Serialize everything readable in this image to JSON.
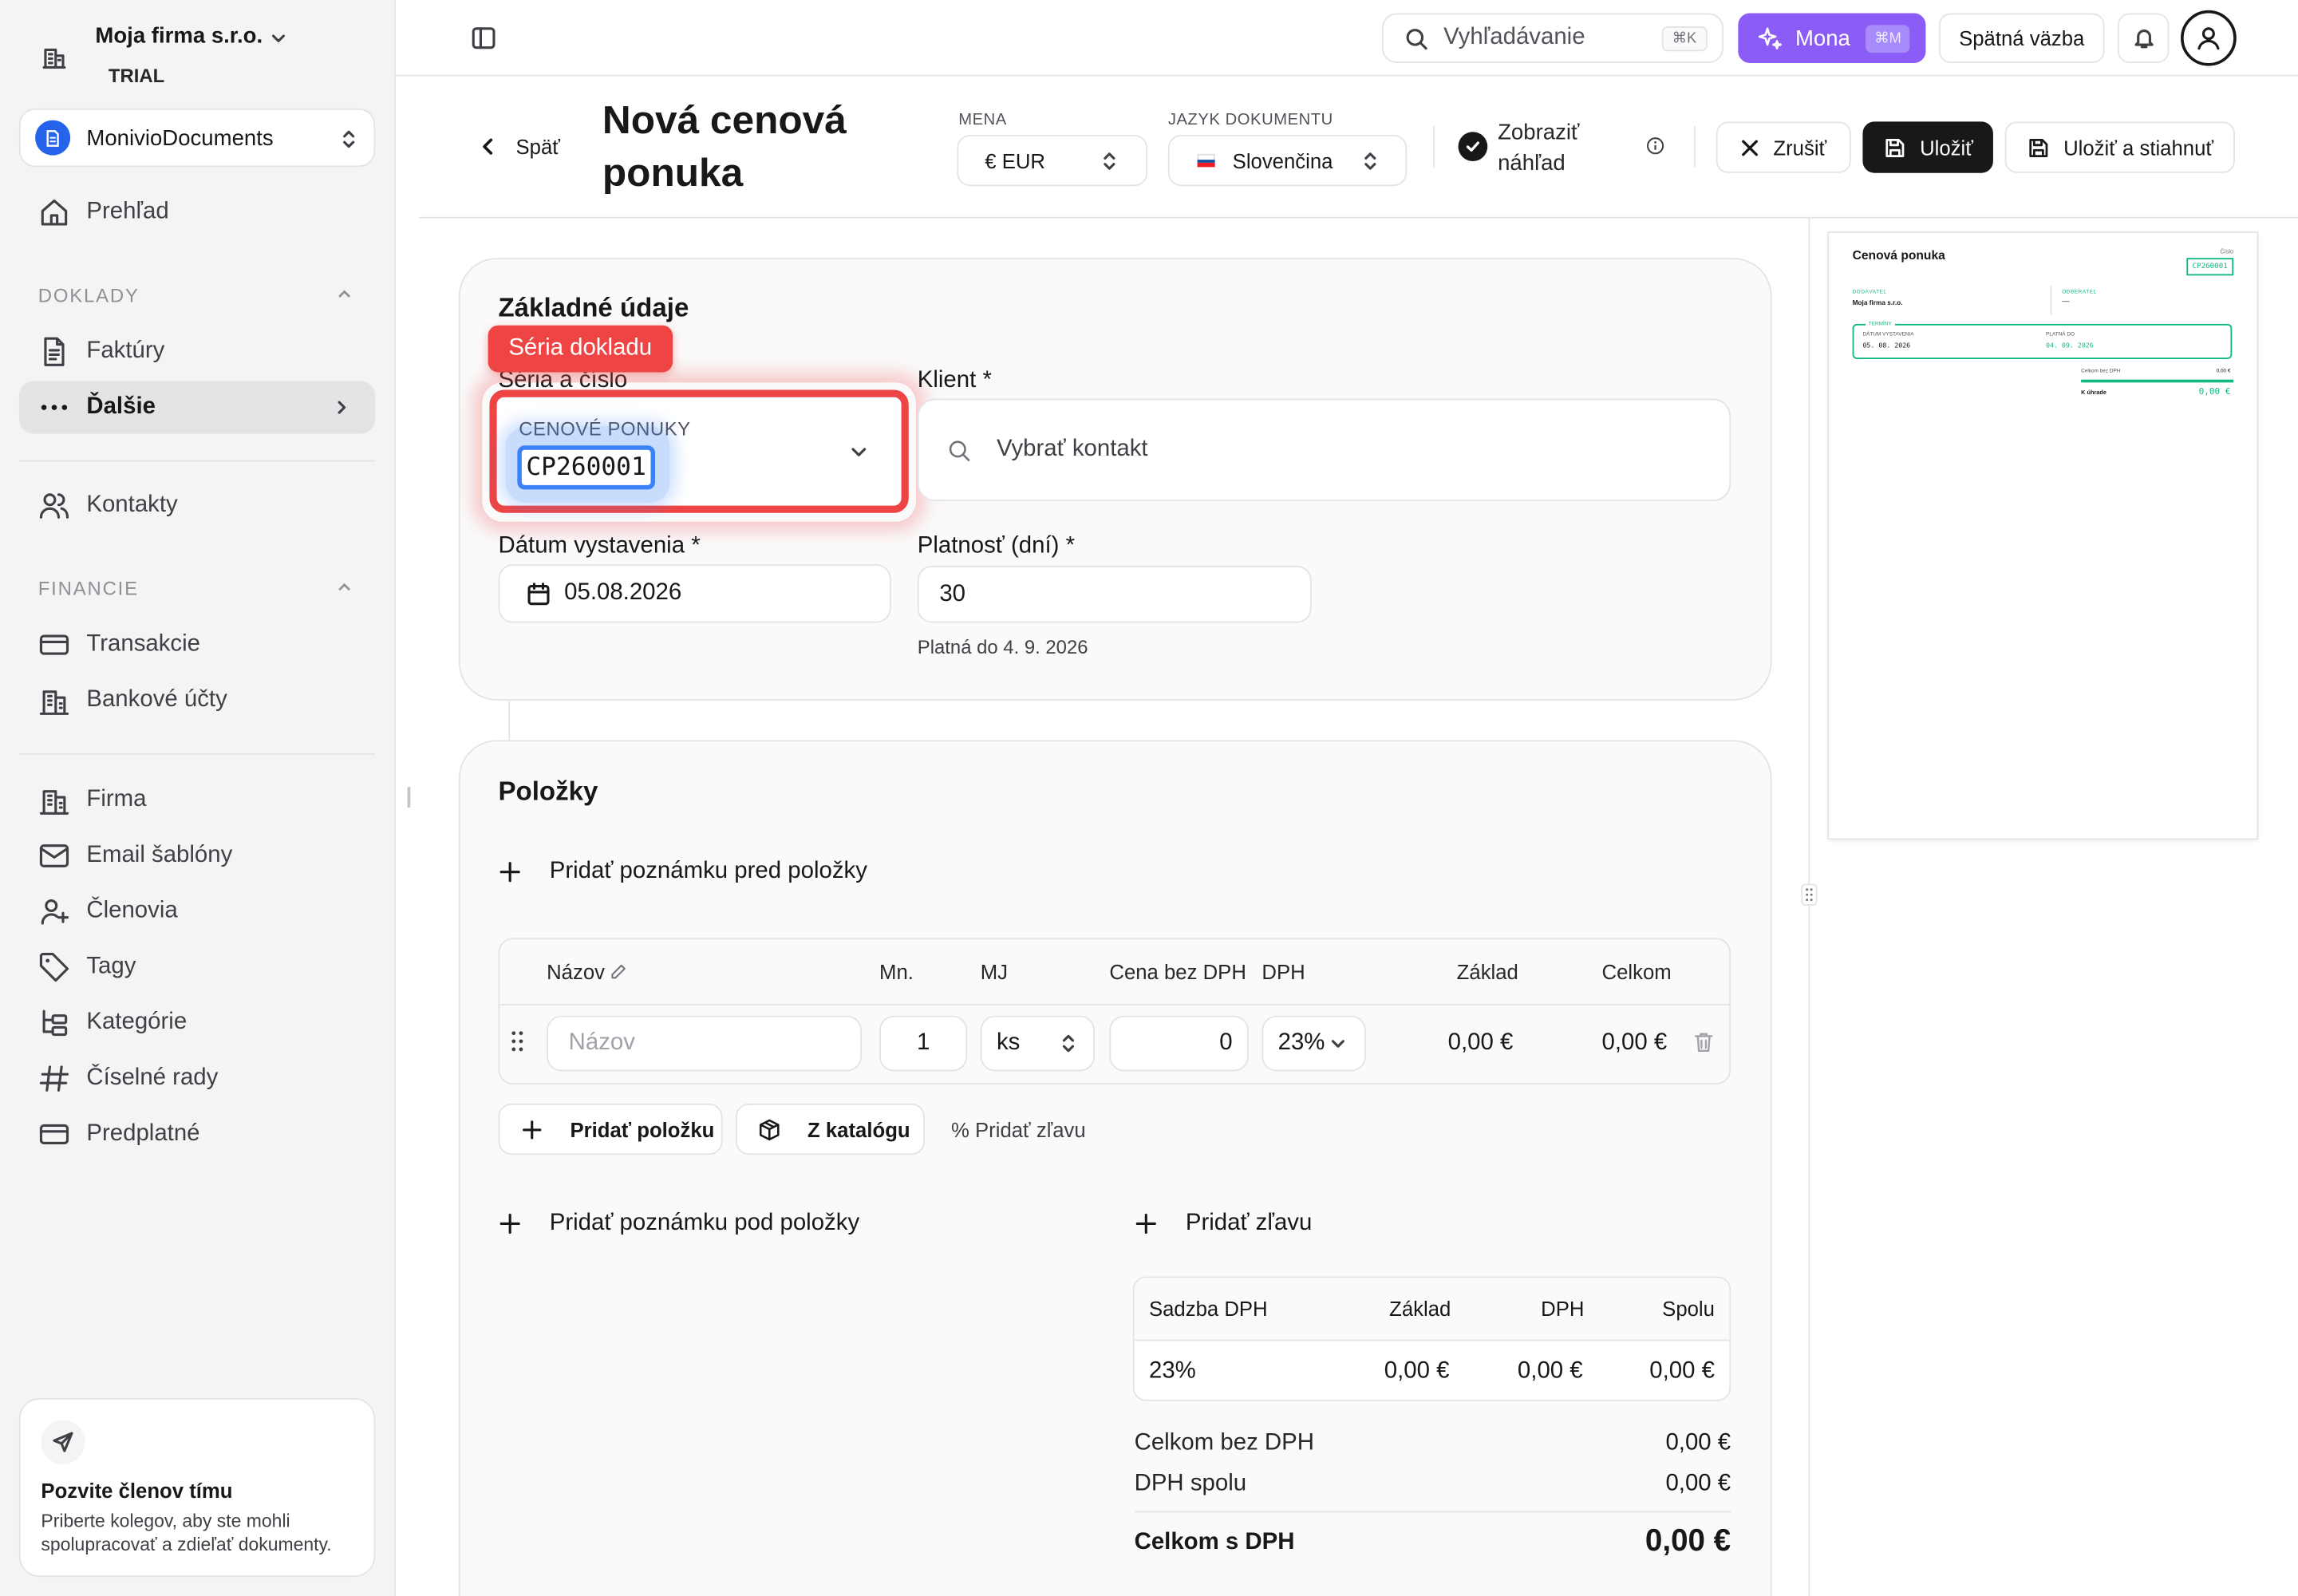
{
  "sidebar": {
    "company_name": "Moja firma s.r.o.",
    "company_plan": "TRIAL",
    "workspace_name": "MonivioDocuments",
    "overview": "Prehľad",
    "section_documents": "DOKLADY",
    "invoices": "Faktúry",
    "more": "Ďalšie",
    "contacts": "Kontakty",
    "section_finance": "FINANCIE",
    "transactions": "Transakcie",
    "bank_accounts": "Bankové účty",
    "company": "Firma",
    "email_templates": "Email šablóny",
    "members": "Členovia",
    "tags": "Tagy",
    "categories": "Kategórie",
    "number_series": "Číselné rady",
    "subscription": "Predplatné",
    "invite_title": "Pozvite členov tímu",
    "invite_text": "Priberte kolegov, aby ste mohli spolupracovať a zdieľať dokumenty."
  },
  "topbar": {
    "search_placeholder": "Vyhľadávanie",
    "search_shortcut": "⌘K",
    "ai_label": "Mona",
    "ai_shortcut": "⌘M",
    "feedback": "Spätná väzba"
  },
  "header": {
    "back": "Späť",
    "title_line1": "Nová cenová",
    "title_line2": "ponuka",
    "currency_label": "MENA",
    "currency_value": "€ EUR",
    "language_label": "JAZYK DOKUMENTU",
    "language_value": "Slovenčina",
    "preview_line1": "Zobraziť",
    "preview_line2": "náhľad",
    "cancel": "Zrušiť",
    "save": "Uložiť",
    "save_download": "Uložiť a stiahnuť"
  },
  "basic": {
    "title": "Základné údaje",
    "tooltip": "Séria dokladu",
    "series_label": "Séria a číslo",
    "series_name": "CENOVÉ PONUKY",
    "series_number": "CP260001",
    "client_label": "Klient *",
    "client_placeholder": "Vybrať kontakt",
    "issue_date_label": "Dátum vystavenia *",
    "issue_date": "05.08.2026",
    "validity_label": "Platnosť (dní) *",
    "validity": "30",
    "valid_until": "Platná do 4. 9. 2026"
  },
  "items": {
    "title": "Položky",
    "add_note_before": "Pridať poznámku pred položky",
    "columns": [
      "Názov",
      "Mn.",
      "MJ",
      "Cena bez DPH",
      "DPH",
      "Základ",
      "Celkom"
    ],
    "row": {
      "name_placeholder": "Názov",
      "qty": "1",
      "unit": "ks",
      "price": "0",
      "vat": "23%",
      "base": "0,00 €",
      "total": "0,00 €"
    },
    "add_item": "Pridať položku",
    "from_catalog": "Z katalógu",
    "add_discount_small": "% Pridať zľavu",
    "add_note_after": "Pridať poznámku pod položky",
    "add_discount": "Pridať zľavu"
  },
  "summary": {
    "columns": [
      "Sadzba DPH",
      "Základ",
      "DPH",
      "Spolu"
    ],
    "row": [
      "23%",
      "0,00 €",
      "0,00 €",
      "0,00 €"
    ],
    "total_without_vat_label": "Celkom bez DPH",
    "total_without_vat": "0,00 €",
    "vat_total_label": "DPH spolu",
    "vat_total": "0,00 €",
    "total_with_vat_label": "Celkom s DPH",
    "total_with_vat": "0,00 €"
  },
  "preview": {
    "title": "Cenová ponuka",
    "number_label": "Číslo",
    "number": "CP260001",
    "supplier_label": "DODÁVATEĽ",
    "supplier": "Moja firma s.r.o.",
    "customer_label": "ODBERATEĽ",
    "customer": "—",
    "terms_label": "TERMÍNY",
    "issue_label": "DÁTUM VYSTAVENIA",
    "issue": "05. 08. 2026",
    "valid_label": "PLATNÁ DO",
    "valid": "04. 09. 2026",
    "sum_label": "Celkom bez DPH",
    "sum": "0,00 €",
    "due_label": "K úhrade",
    "due": "0,00 €"
  },
  "colors": {
    "accent_ai": "#8b5cf6",
    "highlight_red": "#ef4444",
    "selection_blue": "#3b82f6",
    "preview_green": "#10b981",
    "primary_dark": "#18181b"
  }
}
